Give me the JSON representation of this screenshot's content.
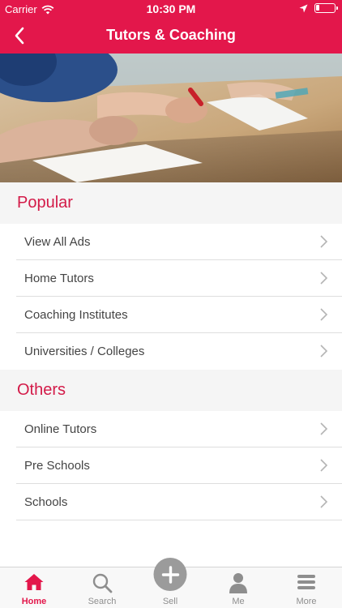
{
  "status_bar": {
    "carrier": "Carrier",
    "time": "10:30 PM"
  },
  "nav": {
    "title": "Tutors & Coaching"
  },
  "sections": [
    {
      "title": "Popular",
      "items": [
        "View All Ads",
        "Home Tutors",
        "Coaching Institutes",
        "Universities / Colleges"
      ]
    },
    {
      "title": "Others",
      "items": [
        "Online Tutors",
        "Pre Schools",
        "Schools"
      ]
    }
  ],
  "tabs": [
    {
      "label": "Home",
      "icon": "home-icon",
      "active": true
    },
    {
      "label": "Search",
      "icon": "search-icon"
    },
    {
      "label": "Sell",
      "icon": "plus-icon"
    },
    {
      "label": "Me",
      "icon": "person-icon"
    },
    {
      "label": "More",
      "icon": "menu-icon"
    }
  ],
  "colors": {
    "brand": "#e3174b",
    "section_title": "#d31a48",
    "inactive": "#8e8e8e"
  }
}
